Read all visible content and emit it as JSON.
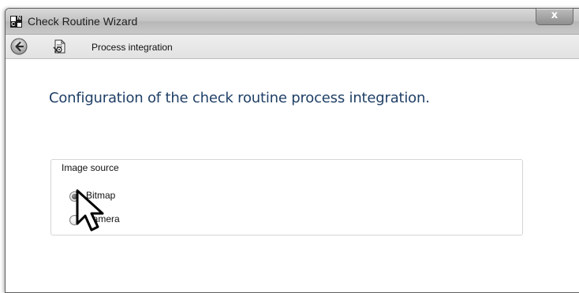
{
  "window": {
    "title": "Check Routine Wizard",
    "close_symbol": "x",
    "app_icon_letters": "NC"
  },
  "nav": {
    "step_title": "Process integration",
    "back_icon": "back-arrow-icon",
    "step_icon": "document-settings-icon"
  },
  "content": {
    "heading": "Configuration of the check routine process integration."
  },
  "image_source": {
    "label": "Image source",
    "options": [
      {
        "label": "Bitmap",
        "checked": true
      },
      {
        "label": "Camera",
        "checked": false
      }
    ]
  }
}
